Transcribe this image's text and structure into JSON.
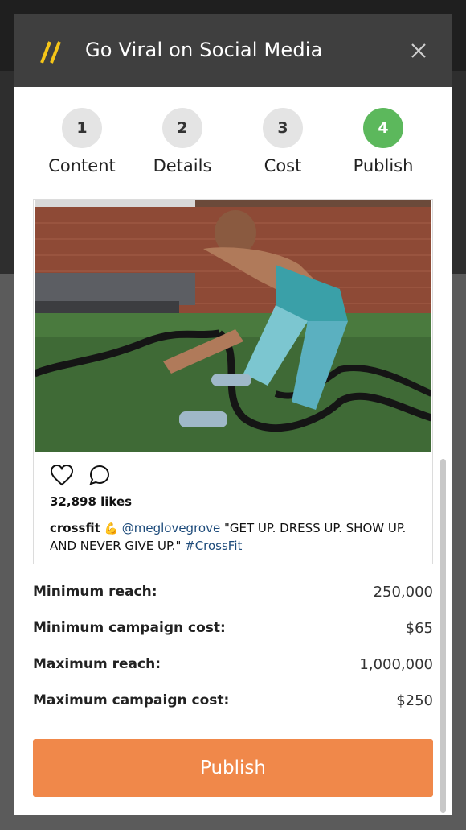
{
  "modal": {
    "title": "Go Viral on Social Media"
  },
  "steps": [
    {
      "number": "1",
      "label": "Content",
      "active": false
    },
    {
      "number": "2",
      "label": "Details",
      "active": false
    },
    {
      "number": "3",
      "label": "Cost",
      "active": false
    },
    {
      "number": "4",
      "label": "Publish",
      "active": true
    }
  ],
  "post": {
    "likes": "32,898 likes",
    "username": "crossfit",
    "mention": "@meglovegrove",
    "quote": "\"GET UP. DRESS UP. SHOW UP. AND NEVER GIVE UP.\"",
    "hashtag": "#CrossFit"
  },
  "stats": [
    {
      "label": "Minimum reach:",
      "value": "250,000"
    },
    {
      "label": "Minimum campaign cost:",
      "value": "$65"
    },
    {
      "label": "Maximum reach:",
      "value": "1,000,000"
    },
    {
      "label": "Maximum campaign cost:",
      "value": "$250"
    }
  ],
  "publish_button": "Publish",
  "colors": {
    "header_bg": "#3f3f3f",
    "logo_accent": "#f5c518",
    "step_active": "#5cb85c",
    "publish_button": "#f0884a",
    "link": "#1c4a7a"
  },
  "icons": [
    "logo-slashes-icon",
    "close-icon",
    "heart-icon",
    "comment-icon",
    "flexed-biceps-icon"
  ]
}
